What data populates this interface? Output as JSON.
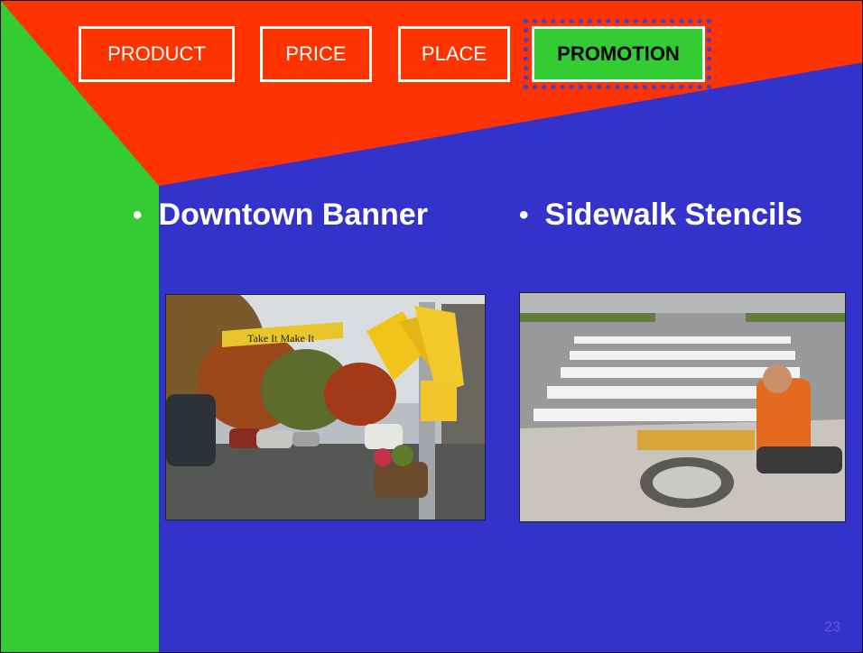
{
  "nav": {
    "tabs": [
      "PRODUCT",
      "PRICE",
      "PLACE",
      "PROMOTION"
    ],
    "active": "PROMOTION"
  },
  "bullets": [
    {
      "marker": "•",
      "text": "Downtown Banner"
    },
    {
      "marker": "•",
      "text": "Sidewalk Stencils"
    }
  ],
  "photos": {
    "banner_text": "Take It  Make It",
    "sign_text": "Take It Make It"
  },
  "page_number": "23",
  "colors": {
    "background": "#3333cc",
    "header": "#ff3300",
    "sidebar": "#33cc33",
    "active_tab": "#33cc33",
    "dotted_outline": "#4141c8"
  }
}
